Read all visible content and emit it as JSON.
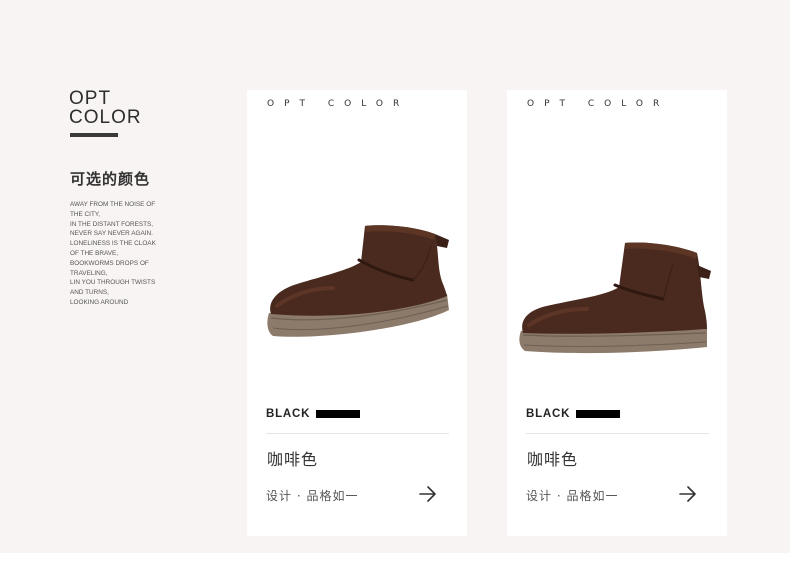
{
  "section": {
    "heading_line1": "OPT",
    "heading_line2": "COLOR",
    "cn_title": "可选的颜色",
    "poem_lines": [
      "AWAY FROM THE NOISE OF",
      "THE CITY,",
      "IN THE DISTANT FORESTS,",
      "NEVER SAY NEVER AGAIN.",
      "LONELINESS IS THE CLOAK",
      "OF THE BRAVE,",
      "BOOKWORMS DROPS OF",
      "TRAVELING,",
      "LIN YOU THROUGH TWISTS",
      "AND TURNS,",
      "LOOKING AROUND"
    ]
  },
  "cards": [
    {
      "top_label": "OPT COLOR",
      "label": "BLACK",
      "color_name": "咖啡色",
      "meta": "设计 · 品格如一",
      "arrow_icon": "arrow-right-icon",
      "product_image": "brown suede ankle boot"
    },
    {
      "top_label": "OPT COLOR",
      "label": "BLACK",
      "color_name": "咖啡色",
      "meta": "设计 · 品格如一",
      "arrow_icon": "arrow-right-icon",
      "product_image": "brown suede ankle boot"
    }
  ],
  "colors": {
    "panel_background": "#f8f4f3",
    "card_background": "#ffffff",
    "suede_brown": "#4a2a1e",
    "sole_tan": "#8c7a6a"
  }
}
